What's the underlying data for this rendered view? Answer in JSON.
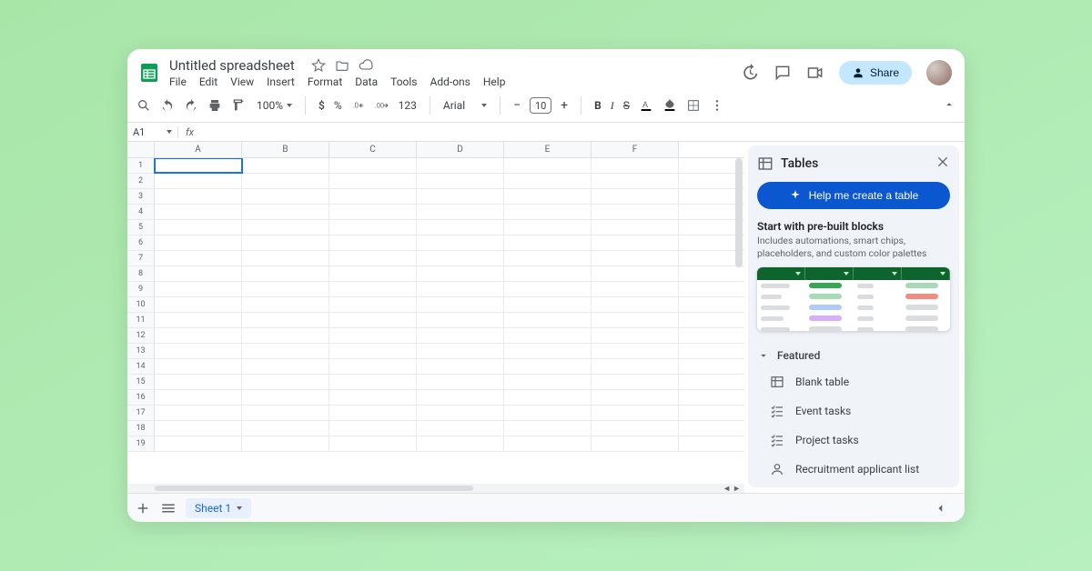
{
  "doc": {
    "title": "Untitled spreadsheet"
  },
  "menubar": [
    "File",
    "Edit",
    "View",
    "Insert",
    "Format",
    "Data",
    "Tools",
    "Add-ons",
    "Help"
  ],
  "toolbar": {
    "zoom": "100%",
    "number_123": "123",
    "font_name": "Arial",
    "font_size": "10"
  },
  "share_label": "Share",
  "namebox": "A1",
  "columns": [
    "A",
    "B",
    "C",
    "D",
    "E",
    "F"
  ],
  "rows": 19,
  "sheet_tab": "Sheet 1",
  "sidepanel": {
    "title": "Tables",
    "help_button": "Help me create a table",
    "blocks_title": "Start with pre-built blocks",
    "blocks_desc": "Includes automations, smart chips, placeholders, and custom color palettes",
    "section": "Featured",
    "items": [
      {
        "icon": "table",
        "label": "Blank table"
      },
      {
        "icon": "tasks",
        "label": "Event tasks"
      },
      {
        "icon": "tasks",
        "label": "Project tasks"
      },
      {
        "icon": "person",
        "label": "Recruitment applicant list"
      }
    ]
  }
}
